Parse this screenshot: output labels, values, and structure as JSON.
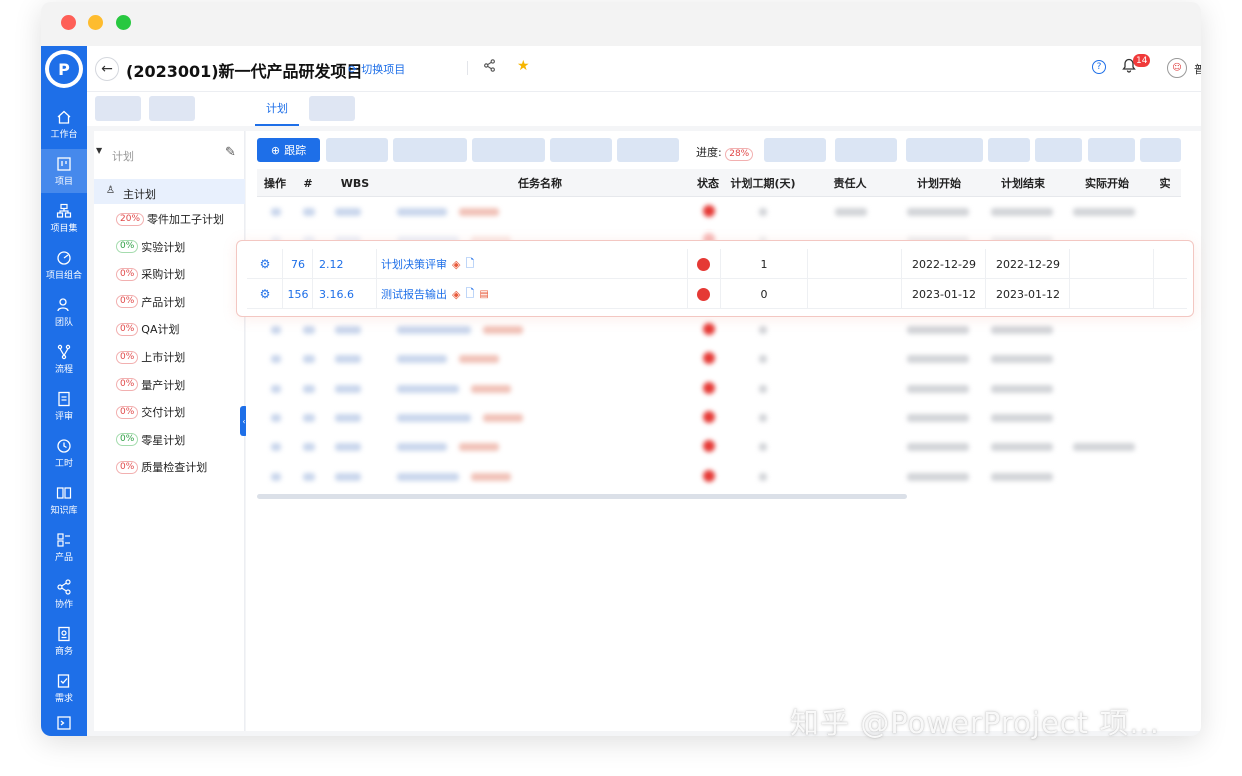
{
  "header": {
    "project_title": "(2023001)新一代产品研发项目",
    "switch_label": "切换项目",
    "notification_count": "14",
    "user_name": "普明"
  },
  "nav": {
    "items": [
      {
        "label": "工作台",
        "icon": "home-icon"
      },
      {
        "label": "项目",
        "icon": "project-icon",
        "active": true
      },
      {
        "label": "项目集",
        "icon": "program-icon"
      },
      {
        "label": "项目组合",
        "icon": "portfolio-icon"
      },
      {
        "label": "团队",
        "icon": "team-icon"
      },
      {
        "label": "流程",
        "icon": "flow-icon"
      },
      {
        "label": "评审",
        "icon": "review-icon"
      },
      {
        "label": "工时",
        "icon": "clock-icon"
      },
      {
        "label": "知识库",
        "icon": "book-icon"
      },
      {
        "label": "产品",
        "icon": "product-icon"
      },
      {
        "label": "协作",
        "icon": "share-icon"
      },
      {
        "label": "商务",
        "icon": "business-icon"
      },
      {
        "label": "需求",
        "icon": "requirement-icon"
      }
    ]
  },
  "tabs": {
    "active_label": "计划"
  },
  "plan_tree": {
    "header": "计划",
    "main_plan": "主计划",
    "items": [
      {
        "pct": "20%",
        "label": "零件加工子计划",
        "status": "red"
      },
      {
        "pct": "0%",
        "label": "实验计划",
        "status": "green"
      },
      {
        "pct": "0%",
        "label": "采购计划",
        "status": "red"
      },
      {
        "pct": "0%",
        "label": "产品计划",
        "status": "red"
      },
      {
        "pct": "0%",
        "label": "QA计划",
        "status": "red"
      },
      {
        "pct": "0%",
        "label": "上市计划",
        "status": "red"
      },
      {
        "pct": "0%",
        "label": "量产计划",
        "status": "red"
      },
      {
        "pct": "0%",
        "label": "交付计划",
        "status": "red"
      },
      {
        "pct": "0%",
        "label": "零星计划",
        "status": "green"
      },
      {
        "pct": "0%",
        "label": "质量检查计划",
        "status": "red"
      }
    ]
  },
  "toolbar": {
    "track_label": "跟踪",
    "progress_label": "进度:",
    "progress_value": "28%"
  },
  "table": {
    "columns": [
      "操作",
      "#",
      "WBS",
      "任务名称",
      "状态",
      "计划工期(天)",
      "责任人",
      "计划开始",
      "计划结束",
      "实际开始",
      "实"
    ],
    "highlighted_rows": [
      {
        "num": "76",
        "wbs": "2.12",
        "name": "计划决策评审",
        "duration": "1",
        "start": "2022-12-29",
        "end": "2022-12-29",
        "has_sheet_icon": false
      },
      {
        "num": "156",
        "wbs": "3.16.6",
        "name": "测试报告输出",
        "duration": "0",
        "start": "2023-01-12",
        "end": "2023-01-12",
        "has_sheet_icon": true
      }
    ]
  },
  "watermark": "知乎 @PowerProject 项..."
}
